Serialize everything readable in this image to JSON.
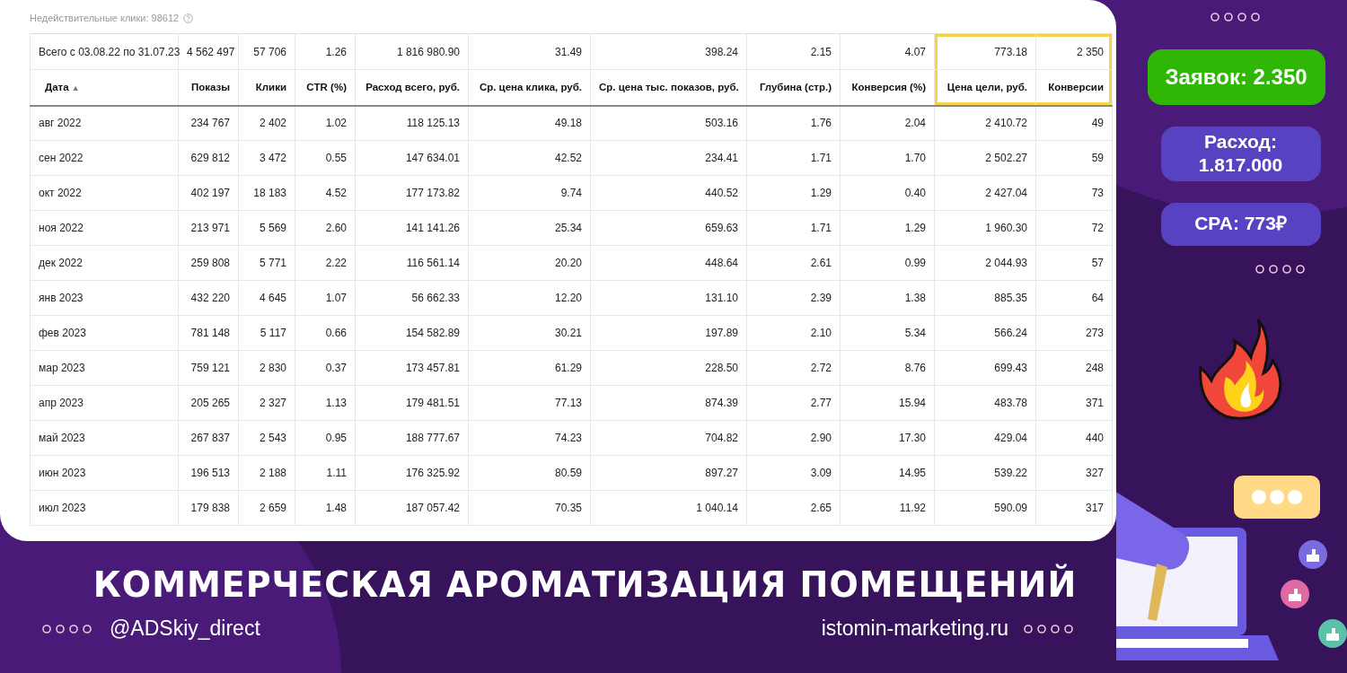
{
  "report": {
    "invalid_clicks": "Недействительные клики: 98612",
    "table": {
      "columns": [
        {
          "label": "Дата",
          "sort": "▲",
          "highlighted": false
        },
        {
          "label": "Показы",
          "highlighted": false
        },
        {
          "label": "Клики",
          "highlighted": false
        },
        {
          "label": "CTR (%)",
          "highlighted": false
        },
        {
          "label": "Расход всего, руб.",
          "highlighted": false
        },
        {
          "label": "Ср. цена клика, руб.",
          "highlighted": false
        },
        {
          "label": "Ср. цена тыс. показов, руб.",
          "highlighted": false
        },
        {
          "label": "Глубина (стр.)",
          "highlighted": false
        },
        {
          "label": "Конверсия (%)",
          "highlighted": false
        },
        {
          "label": "Цена цели, руб.",
          "highlighted": true
        },
        {
          "label": "Конверсии",
          "highlighted": true
        }
      ],
      "totals": [
        "Всего с 03.08.22 по 31.07.23",
        "4 562 497",
        "57 706",
        "1.26",
        "1 816 980.90",
        "31.49",
        "398.24",
        "2.15",
        "4.07",
        "773.18",
        "2 350"
      ],
      "rows": [
        [
          "авг 2022",
          "234 767",
          "2 402",
          "1.02",
          "118 125.13",
          "49.18",
          "503.16",
          "1.76",
          "2.04",
          "2 410.72",
          "49"
        ],
        [
          "сен 2022",
          "629 812",
          "3 472",
          "0.55",
          "147 634.01",
          "42.52",
          "234.41",
          "1.71",
          "1.70",
          "2 502.27",
          "59"
        ],
        [
          "окт 2022",
          "402 197",
          "18 183",
          "4.52",
          "177 173.82",
          "9.74",
          "440.52",
          "1.29",
          "0.40",
          "2 427.04",
          "73"
        ],
        [
          "ноя 2022",
          "213 971",
          "5 569",
          "2.60",
          "141 141.26",
          "25.34",
          "659.63",
          "1.71",
          "1.29",
          "1 960.30",
          "72"
        ],
        [
          "дек 2022",
          "259 808",
          "5 771",
          "2.22",
          "116 561.14",
          "20.20",
          "448.64",
          "2.61",
          "0.99",
          "2 044.93",
          "57"
        ],
        [
          "янв 2023",
          "432 220",
          "4 645",
          "1.07",
          "56 662.33",
          "12.20",
          "131.10",
          "2.39",
          "1.38",
          "885.35",
          "64"
        ],
        [
          "фев 2023",
          "781 148",
          "5 117",
          "0.66",
          "154 582.89",
          "30.21",
          "197.89",
          "2.10",
          "5.34",
          "566.24",
          "273"
        ],
        [
          "мар 2023",
          "759 121",
          "2 830",
          "0.37",
          "173 457.81",
          "61.29",
          "228.50",
          "2.72",
          "8.76",
          "699.43",
          "248"
        ],
        [
          "апр 2023",
          "205 265",
          "2 327",
          "1.13",
          "179 481.51",
          "77.13",
          "874.39",
          "2.77",
          "15.94",
          "483.78",
          "371"
        ],
        [
          "май 2023",
          "267 837",
          "2 543",
          "0.95",
          "188 777.67",
          "74.23",
          "704.82",
          "2.90",
          "17.30",
          "429.04",
          "440"
        ],
        [
          "июн 2023",
          "196 513",
          "2 188",
          "1.11",
          "176 325.92",
          "80.59",
          "897.27",
          "3.09",
          "14.95",
          "539.22",
          "327"
        ],
        [
          "июл 2023",
          "179 838",
          "2 659",
          "1.48",
          "187 057.42",
          "70.35",
          "1 040.14",
          "2.65",
          "11.92",
          "590.09",
          "317"
        ]
      ]
    }
  },
  "stats": [
    {
      "text": "Заявок: 2.350",
      "kind": "primary"
    },
    {
      "text": "Расход: 1.817.000",
      "kind": "secondary"
    },
    {
      "text": "CPA: 773₽",
      "kind": "secondary"
    }
  ],
  "footer": {
    "title": "КОММЕРЧЕСКАЯ АРОМАТИЗАЦИЯ ПОМЕЩЕНИЙ",
    "handle": "@ADSkiy_direct",
    "website": "istomin-marketing.ru"
  }
}
